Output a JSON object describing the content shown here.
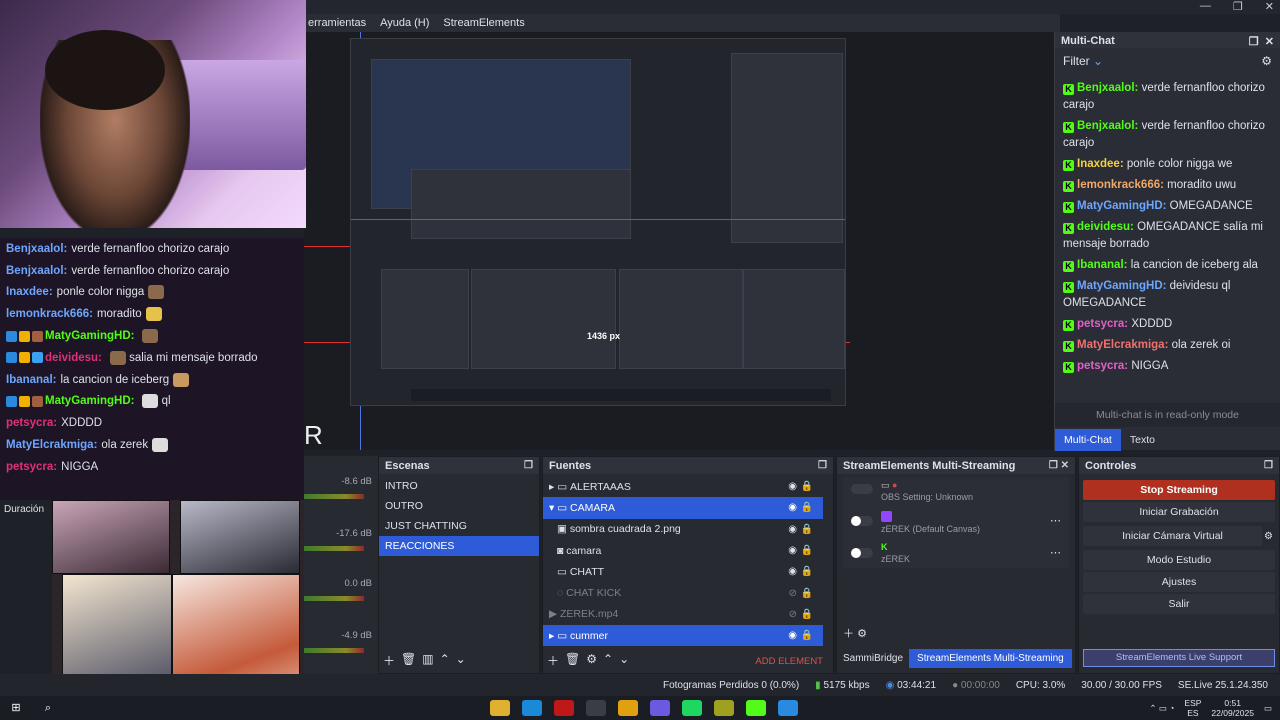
{
  "menu": {
    "items": [
      "erramientas",
      "Ayuda (H)",
      "StreamElements"
    ]
  },
  "overlay_chat": [
    {
      "user": "Benjxaalol:",
      "text": "verde fernanfloo chorizo carajo",
      "color": "#6ea6ff",
      "emote": false
    },
    {
      "user": "Benjxaalol:",
      "text": "verde fernanfloo chorizo carajo",
      "color": "#6ea6ff",
      "emote": false
    },
    {
      "user": "Inaxdee:",
      "text": "ponle color nigga",
      "color": "#6ea6ff",
      "emote": true
    },
    {
      "user": "lemonkrack666:",
      "text": "moradito",
      "color": "#6ea6ff",
      "emote": true
    },
    {
      "user": "MatyGamingHD:",
      "text": "",
      "color": "#53fc18",
      "emote": true,
      "badges": true
    },
    {
      "user": "deividesu:",
      "text": "salia mi mensaje borrado",
      "color": "#e0307a",
      "emote": true,
      "badges": true
    },
    {
      "user": "Ibananal:",
      "text": "la cancion de iceberg",
      "color": "#6ea6ff",
      "emote": true
    },
    {
      "user": "MatyGamingHD:",
      "text": "ql",
      "color": "#53fc18",
      "emote": true,
      "badges": true
    },
    {
      "user": "petsycra:",
      "text": "XDDDD",
      "color": "#e0307a",
      "emote": false
    },
    {
      "user": "MatyElcrakmiga:",
      "text": "ola zerek",
      "color": "#6ea6ff",
      "emote": true
    },
    {
      "user": "petsycra:",
      "text": "NIGGA",
      "color": "#e0307a",
      "emote": false
    }
  ],
  "multichat": {
    "title": "Multi-Chat",
    "filter_label": "Filter",
    "messages": [
      {
        "user": "Benjxaalol:",
        "text": "verde fernanfloo chorizo carajo",
        "color": "#53fc18"
      },
      {
        "user": "Benjxaalol:",
        "text": "verde fernanfloo chorizo carajo",
        "color": "#53fc18"
      },
      {
        "user": "Inaxdee:",
        "text": "ponle color nigga we",
        "color": "#f5d142"
      },
      {
        "user": "lemonkrack666:",
        "text": "moradito uwu",
        "color": "#f0a868"
      },
      {
        "user": "MatyGamingHD:",
        "text": "OMEGADANCE",
        "color": "#6ea6ff"
      },
      {
        "user": "deividesu:",
        "text": "OMEGADANCE salía mi mensaje borrado",
        "color": "#53fc18"
      },
      {
        "user": "Ibananal:",
        "text": "la cancion de iceberg ala",
        "color": "#53fc18"
      },
      {
        "user": "MatyGamingHD:",
        "text": "deividesu ql OMEGADANCE",
        "color": "#6ea6ff"
      },
      {
        "user": "petsycra:",
        "text": "XDDDD",
        "color": "#e060c8"
      },
      {
        "user": "MatyElcrakmiga:",
        "text": "ola zerek oi",
        "color": "#f07070"
      },
      {
        "user": "petsycra:",
        "text": "NIGGA",
        "color": "#e060c8"
      }
    ],
    "readonly_note": "Multi-chat is in read-only mode",
    "tabs": [
      "Multi-Chat",
      "Texto"
    ]
  },
  "mixer": {
    "label": "Duración",
    "levels": [
      "-8.6 dB",
      "-17.6 dB",
      "0.0 dB",
      "-4.9 dB"
    ]
  },
  "scenes": {
    "title": "Escenas",
    "items": [
      "INTRO",
      "OUTRO",
      "JUST CHATTING",
      "REACCIONES"
    ],
    "selected": 3
  },
  "sources": {
    "title": "Fuentes",
    "items": [
      {
        "label": "ALERTAAAS",
        "type": "group",
        "state": "normal"
      },
      {
        "label": "CAMARA",
        "type": "group",
        "state": "selected"
      },
      {
        "label": "sombra cuadrada 2.png",
        "type": "image",
        "state": "normal"
      },
      {
        "label": "camara",
        "type": "camera",
        "state": "normal"
      },
      {
        "label": "CHATT",
        "type": "browser",
        "state": "normal"
      },
      {
        "label": "CHAT KICK",
        "type": "browser",
        "state": "hidden"
      },
      {
        "label": "ZEREK.mp4",
        "type": "media",
        "state": "hidden"
      },
      {
        "label": "cummer",
        "type": "group",
        "state": "selected"
      }
    ],
    "add_element": "ADD ELEMENT"
  },
  "multistream": {
    "title": "StreamElements Multi-Streaming",
    "rows": [
      {
        "name": "OBS Setting: Unknown",
        "platform": "obs"
      },
      {
        "name": "zEREK (Default Canvas)",
        "platform": "twitch"
      },
      {
        "name": "zEREK",
        "platform": "kick"
      }
    ],
    "tabs": [
      "SammiBridge",
      "StreamElements Multi-Streaming"
    ]
  },
  "controls": {
    "title": "Controles",
    "buttons": [
      "Stop Streaming",
      "Iniciar Grabación",
      "Iniciar Cámara Virtual",
      "Modo Estudio",
      "Ajustes",
      "Salir"
    ],
    "support": "StreamElements Live Support"
  },
  "status": {
    "dropped": "Fotogramas Perdidos 0 (0.0%)",
    "bitrate": "5175 kbps",
    "live_time": "03:44:21",
    "rec_time": "00:00:00",
    "cpu": "CPU: 3.0%",
    "fps": "30.00 / 30.00 FPS",
    "version": "SE.Live 25.1.24.350"
  },
  "capture": {
    "px_label": "1436 px"
  },
  "taskbar": {
    "lang": "ESP",
    "lang2": "ES",
    "time": "0:51",
    "date": "22/09/2025"
  }
}
